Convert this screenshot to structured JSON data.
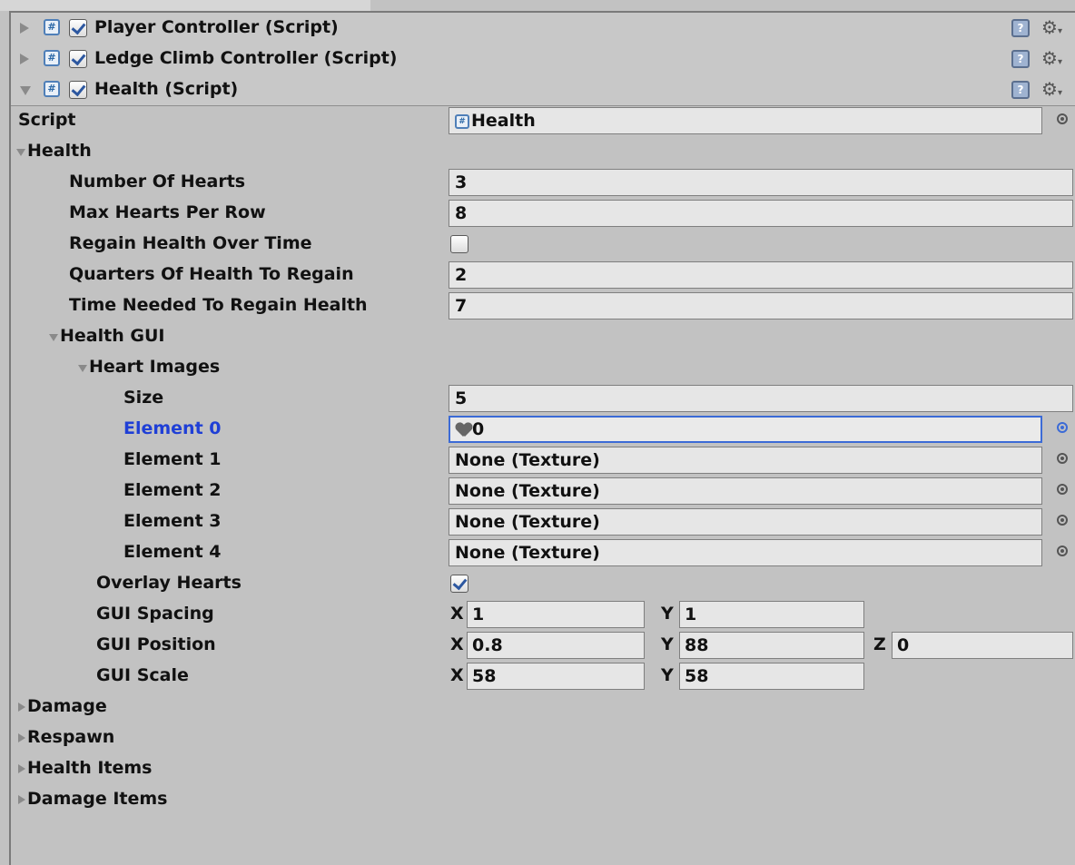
{
  "components": [
    {
      "title": "Player Controller (Script)",
      "enabled": true,
      "expanded": false
    },
    {
      "title": "Ledge Climb Controller (Script)",
      "enabled": true,
      "expanded": false
    },
    {
      "title": "Health (Script)",
      "enabled": true,
      "expanded": true
    }
  ],
  "script_row": {
    "label": "Script",
    "value": "Health"
  },
  "health_section": {
    "label": "Health"
  },
  "fields": {
    "number_of_hearts": {
      "label": "Number Of Hearts",
      "value": "3"
    },
    "max_hearts_per_row": {
      "label": "Max Hearts Per Row",
      "value": "8"
    },
    "regain_health_over_time": {
      "label": "Regain Health Over Time",
      "checked": false
    },
    "quarters_of_health_to_regain": {
      "label": "Quarters Of Health To Regain",
      "value": "2"
    },
    "time_needed_to_regain_health": {
      "label": "Time Needed To Regain Health",
      "value": "7"
    }
  },
  "health_gui": {
    "label": "Health GUI"
  },
  "heart_images": {
    "label": "Heart Images",
    "size_label": "Size",
    "size_value": "5",
    "elements": [
      {
        "label": "Element 0",
        "value": "0",
        "selected": true
      },
      {
        "label": "Element 1",
        "value": "None (Texture)"
      },
      {
        "label": "Element 2",
        "value": "None (Texture)"
      },
      {
        "label": "Element 3",
        "value": "None (Texture)"
      },
      {
        "label": "Element 4",
        "value": "None (Texture)"
      }
    ]
  },
  "overlay_hearts": {
    "label": "Overlay Hearts",
    "checked": true
  },
  "gui_spacing": {
    "label": "GUI Spacing",
    "x_label": "X",
    "x": "1",
    "y_label": "Y",
    "y": "1"
  },
  "gui_position": {
    "label": "GUI Position",
    "x_label": "X",
    "x": "0.8",
    "y_label": "Y",
    "y": "88",
    "z_label": "Z",
    "z": "0"
  },
  "gui_scale": {
    "label": "GUI Scale",
    "x_label": "X",
    "x": "58",
    "y_label": "Y",
    "y": "58"
  },
  "collapsed_sections": [
    {
      "label": "Damage"
    },
    {
      "label": "Respawn"
    },
    {
      "label": "Health Items"
    },
    {
      "label": "Damage Items"
    }
  ],
  "colors": {
    "background": "#c2c2c2",
    "focus": "#3c6bd6",
    "field": "#e6e6e6"
  }
}
